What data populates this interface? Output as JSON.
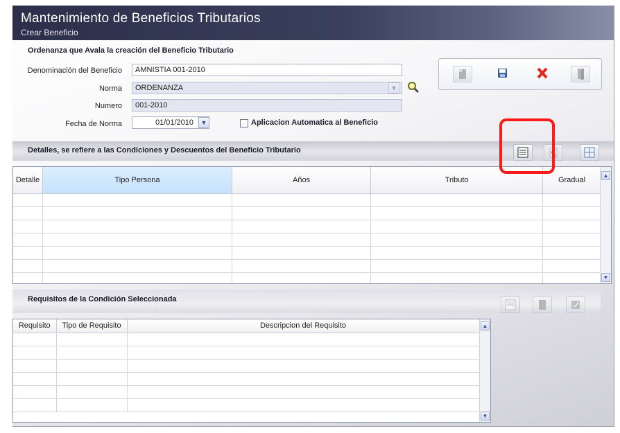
{
  "header": {
    "title": "Mantenimiento de Beneficios Tributarios",
    "subtitle": "Crear Beneficio"
  },
  "ordinance_section": {
    "heading": "Ordenanza que Avala la creación del Beneficio Tributario",
    "fields": {
      "denominacion_label": "Denominación del Beneficio",
      "denominacion_value": "AMNISTIA 001-2010",
      "norma_label": "Norma",
      "norma_value": "ORDENANZA",
      "numero_label": "Numero",
      "numero_value": "001-2010",
      "fecha_label": "Fecha de Norma",
      "fecha_value": "01/01/2010",
      "auto_label": "Aplicacion Automatica al Beneficio"
    }
  },
  "details_section": {
    "heading": "Detalles, se refiere a las Condiciones y Descuentos del Beneficio Tributario",
    "columns": [
      "Detalle",
      "Tipo Persona",
      "Años",
      "Tributo",
      "Gradual"
    ]
  },
  "requirements_section": {
    "heading": "Requisitos de la Condición  Seleccionada",
    "columns": [
      "Requisito",
      "Tipo de Requisito",
      "Descripcion del Requisito"
    ]
  },
  "colors": {
    "accent_highlight": "#ff1a1a",
    "title_bar": "#2b2f4a",
    "selected_header": "#c6e2fb",
    "delete_red": "#e3271b"
  },
  "icons": {
    "search": "search-icon",
    "new": "new-document-icon",
    "save": "save-icon",
    "cancel": "cancel-x-icon",
    "exit": "exit-door-icon",
    "add_row": "add-row-icon",
    "delete_row": "delete-row-icon",
    "edit_row": "edit-row-icon"
  }
}
